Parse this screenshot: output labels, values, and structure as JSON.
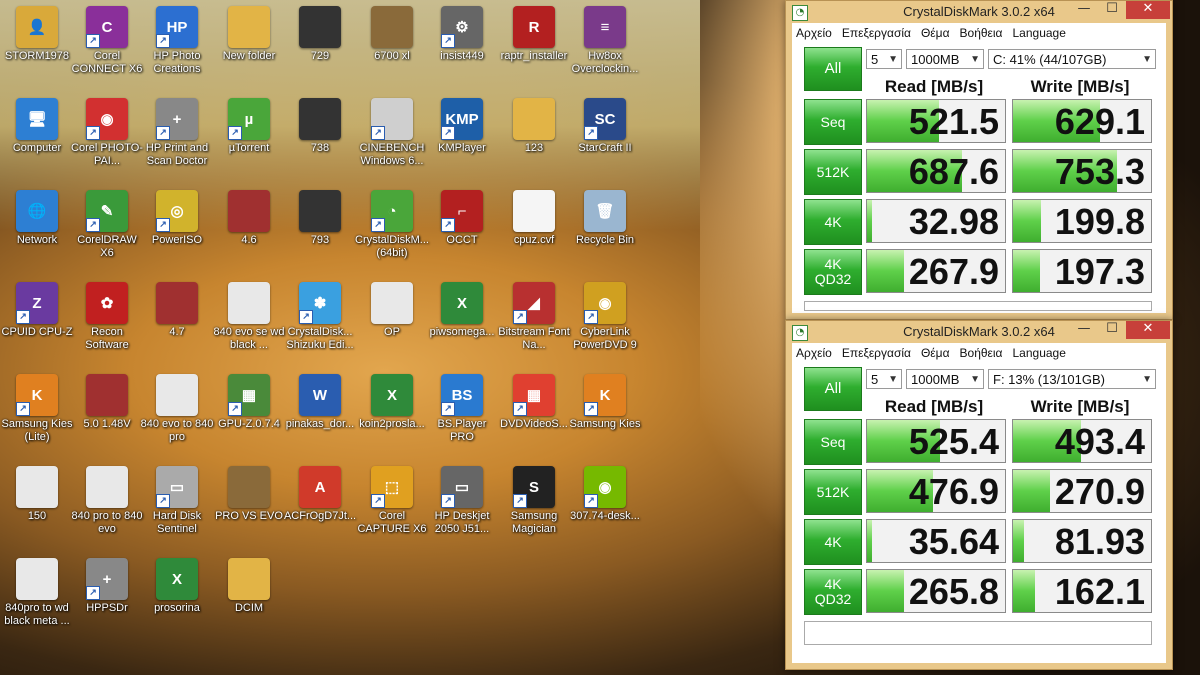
{
  "colors": {
    "window_frame": "#e9c88a",
    "close_button": "#c7403a",
    "green_button": "#2fae2f",
    "bar_green": "#5fd04a"
  },
  "desktop_icons": [
    {
      "label": "STORM1978",
      "icon": "user-folder-icon",
      "color": "#d9a93a",
      "glyph": "👤",
      "shortcut": false
    },
    {
      "label": "Corel CONNECT X6",
      "icon": "corel-connect-icon",
      "color": "#8a2f9a",
      "glyph": "C",
      "shortcut": true
    },
    {
      "label": "HP Photo Creations",
      "icon": "hp-photo-icon",
      "color": "#2c6fd1",
      "glyph": "HP",
      "shortcut": true
    },
    {
      "label": "New folder",
      "icon": "folder-icon",
      "color": "#e2b446",
      "glyph": "",
      "shortcut": false
    },
    {
      "label": "729",
      "icon": "image-thumb-icon",
      "color": "#333333",
      "glyph": "",
      "shortcut": false
    },
    {
      "label": "6700 xl",
      "icon": "image-thumb-icon",
      "color": "#8a6a3a",
      "glyph": "",
      "shortcut": false
    },
    {
      "label": "insist449",
      "icon": "installer-icon",
      "color": "#666666",
      "glyph": "⚙",
      "shortcut": true
    },
    {
      "label": "raptr_installer",
      "icon": "raptr-icon",
      "color": "#b32020",
      "glyph": "R",
      "shortcut": false
    },
    {
      "label": "Hw8ox Overclockin...",
      "icon": "winrar-icon",
      "color": "#7a3a8a",
      "glyph": "≡",
      "shortcut": false
    },
    {
      "label": "Computer",
      "icon": "computer-icon",
      "color": "#2d7fd3",
      "glyph": "🖥",
      "shortcut": false
    },
    {
      "label": "Corel PHOTO-PAI...",
      "icon": "corel-photopaint-icon",
      "color": "#d23030",
      "glyph": "◉",
      "shortcut": true
    },
    {
      "label": "HP Print and Scan Doctor",
      "icon": "hp-doctor-icon",
      "color": "#888888",
      "glyph": "+",
      "shortcut": true
    },
    {
      "label": "µTorrent",
      "icon": "utorrent-icon",
      "color": "#4aa63a",
      "glyph": "µ",
      "shortcut": true
    },
    {
      "label": "738",
      "icon": "image-thumb-icon",
      "color": "#333333",
      "glyph": "",
      "shortcut": false
    },
    {
      "label": "CINEBENCH Windows 6...",
      "icon": "cinebench-icon",
      "color": "#cfcfcf",
      "glyph": "",
      "shortcut": true
    },
    {
      "label": "KMPlayer",
      "icon": "kmplayer-icon",
      "color": "#1e5fa8",
      "glyph": "KMP",
      "shortcut": true
    },
    {
      "label": "123",
      "icon": "folder-icon",
      "color": "#e2b446",
      "glyph": "",
      "shortcut": false
    },
    {
      "label": "StarCraft II",
      "icon": "starcraft-icon",
      "color": "#2a4a8a",
      "glyph": "SC",
      "shortcut": true
    },
    {
      "label": "Network",
      "icon": "network-icon",
      "color": "#2d7fd3",
      "glyph": "🌐",
      "shortcut": false
    },
    {
      "label": "CorelDRAW X6",
      "icon": "coreldraw-icon",
      "color": "#3a9a3a",
      "glyph": "✎",
      "shortcut": true
    },
    {
      "label": "PowerISO",
      "icon": "poweriso-icon",
      "color": "#d1b32c",
      "glyph": "◎",
      "shortcut": true
    },
    {
      "label": "4.6",
      "icon": "image-thumb-icon",
      "color": "#a03030",
      "glyph": "",
      "shortcut": false
    },
    {
      "label": "793",
      "icon": "image-thumb-icon",
      "color": "#333333",
      "glyph": "",
      "shortcut": false
    },
    {
      "label": "CrystalDiskM... (64bit)",
      "icon": "crystaldiskmark-icon",
      "color": "#4aa63a",
      "glyph": "◔",
      "shortcut": true
    },
    {
      "label": "OCCT",
      "icon": "occt-icon",
      "color": "#b32020",
      "glyph": "⌐",
      "shortcut": true
    },
    {
      "label": "cpuz.cvf",
      "icon": "file-icon",
      "color": "#f5f5f5",
      "glyph": "",
      "shortcut": false
    },
    {
      "label": "Recycle Bin",
      "icon": "recycle-bin-icon",
      "color": "#9ab6d0",
      "glyph": "🗑",
      "shortcut": false
    },
    {
      "label": "CPUID CPU-Z",
      "icon": "cpuz-icon",
      "color": "#6a3aa0",
      "glyph": "Z",
      "shortcut": true
    },
    {
      "label": "Recon Software",
      "icon": "recon-icon",
      "color": "#c12020",
      "glyph": "✿",
      "shortcut": false
    },
    {
      "label": "4.7",
      "icon": "image-thumb-icon",
      "color": "#a03030",
      "glyph": "",
      "shortcut": false
    },
    {
      "label": "840 evo se wd black ...",
      "icon": "image-thumb-icon",
      "color": "#e8e8e8",
      "glyph": "",
      "shortcut": false
    },
    {
      "label": "CrystalDisk... Shizuku Edi...",
      "icon": "crystaldisk-shizuku-icon",
      "color": "#3aa0e0",
      "glyph": "✽",
      "shortcut": true
    },
    {
      "label": "OP",
      "icon": "image-thumb-icon",
      "color": "#e8e8e8",
      "glyph": "",
      "shortcut": false
    },
    {
      "label": "piwsomega...",
      "icon": "excel-icon",
      "color": "#2f8a3a",
      "glyph": "X",
      "shortcut": false
    },
    {
      "label": "Bitstream Font Na...",
      "icon": "bitstream-icon",
      "color": "#b83030",
      "glyph": "◢",
      "shortcut": true
    },
    {
      "label": "CyberLink PowerDVD 9",
      "icon": "powerdvd-icon",
      "color": "#d0a020",
      "glyph": "◉",
      "shortcut": true
    },
    {
      "label": "Samsung Kies (Lite)",
      "icon": "kies-lite-icon",
      "color": "#e08020",
      "glyph": "K",
      "shortcut": true
    },
    {
      "label": "5.0 1.48V",
      "icon": "image-thumb-icon",
      "color": "#a03030",
      "glyph": "",
      "shortcut": false
    },
    {
      "label": "840 evo to 840 pro",
      "icon": "image-thumb-icon",
      "color": "#e8e8e8",
      "glyph": "",
      "shortcut": false
    },
    {
      "label": "GPU-Z.0.7.4",
      "icon": "gpuz-icon",
      "color": "#4a8a3a",
      "glyph": "▦",
      "shortcut": true
    },
    {
      "label": "pinakas_dor...",
      "icon": "word-icon",
      "color": "#2a5db0",
      "glyph": "W",
      "shortcut": false
    },
    {
      "label": "koin2prosla...",
      "icon": "excel-icon",
      "color": "#2f8a3a",
      "glyph": "X",
      "shortcut": false
    },
    {
      "label": "BS.Player PRO",
      "icon": "bsplayer-icon",
      "color": "#2a7ad0",
      "glyph": "BS",
      "shortcut": true
    },
    {
      "label": "DVDVideoS...",
      "icon": "dvdvideosoft-icon",
      "color": "#e04030",
      "glyph": "▦",
      "shortcut": true
    },
    {
      "label": "Samsung Kies",
      "icon": "kies-icon",
      "color": "#e08020",
      "glyph": "K",
      "shortcut": true
    },
    {
      "label": "150",
      "icon": "image-thumb-icon",
      "color": "#e8e8e8",
      "glyph": "",
      "shortcut": false
    },
    {
      "label": "840 pro to 840 evo",
      "icon": "image-thumb-icon",
      "color": "#e8e8e8",
      "glyph": "",
      "shortcut": false
    },
    {
      "label": "Hard Disk Sentinel",
      "icon": "hdsentinel-icon",
      "color": "#aaaaaa",
      "glyph": "▭",
      "shortcut": true
    },
    {
      "label": "PRO VS EVO",
      "icon": "image-thumb-icon",
      "color": "#8a6a3a",
      "glyph": "",
      "shortcut": false
    },
    {
      "label": "ACFrOgD7Jt...",
      "icon": "pdf-icon",
      "color": "#d03a2a",
      "glyph": "A",
      "shortcut": false
    },
    {
      "label": "Corel CAPTURE X6",
      "icon": "corel-capture-icon",
      "color": "#e0a020",
      "glyph": "⬚",
      "shortcut": true
    },
    {
      "label": "HP Deskjet 2050 J51...",
      "icon": "printer-icon",
      "color": "#666666",
      "glyph": "▭",
      "shortcut": true
    },
    {
      "label": "Samsung Magician",
      "icon": "samsung-magician-icon",
      "color": "#222222",
      "glyph": "S",
      "shortcut": true
    },
    {
      "label": "307.74-desk...",
      "icon": "nvidia-icon",
      "color": "#76b900",
      "glyph": "◉",
      "shortcut": true
    },
    {
      "label": "840pro to wd black meta ...",
      "icon": "image-thumb-icon",
      "color": "#e8e8e8",
      "glyph": "",
      "shortcut": false
    },
    {
      "label": "HPPSDr",
      "icon": "hppsdr-icon",
      "color": "#888888",
      "glyph": "+",
      "shortcut": true
    },
    {
      "label": "prosorina",
      "icon": "excel-icon",
      "color": "#2f8a3a",
      "glyph": "X",
      "shortcut": false
    },
    {
      "label": "DCIM",
      "icon": "folder-icon",
      "color": "#e2b446",
      "glyph": "",
      "shortcut": false
    }
  ],
  "windows": [
    {
      "title": "CrystalDiskMark 3.0.2 x64",
      "menu": [
        "Αρχείο",
        "Επεξεργασία",
        "Θέμα",
        "Βοήθεια",
        "Language"
      ],
      "all_label": "All",
      "runs": "5",
      "size": "1000MB",
      "drive": "C: 41% (44/107GB)",
      "read_header": "Read [MB/s]",
      "write_header": "Write [MB/s]",
      "rows": [
        {
          "label": "Seq",
          "read": "521.5",
          "write": "629.1"
        },
        {
          "label": "512K",
          "read": "687.6",
          "write": "753.3"
        },
        {
          "label": "4K",
          "read": "32.98",
          "write": "199.8"
        },
        {
          "label": "4K QD32",
          "read": "267.9",
          "write": "197.3"
        }
      ],
      "comment": ""
    },
    {
      "title": "CrystalDiskMark 3.0.2 x64",
      "menu": [
        "Αρχείο",
        "Επεξεργασία",
        "Θέμα",
        "Βοήθεια",
        "Language"
      ],
      "all_label": "All",
      "runs": "5",
      "size": "1000MB",
      "drive": "F: 13% (13/101GB)",
      "read_header": "Read [MB/s]",
      "write_header": "Write [MB/s]",
      "rows": [
        {
          "label": "Seq",
          "read": "525.4",
          "write": "493.4"
        },
        {
          "label": "512K",
          "read": "476.9",
          "write": "270.9"
        },
        {
          "label": "4K",
          "read": "35.64",
          "write": "81.93"
        },
        {
          "label": "4K QD32",
          "read": "265.8",
          "write": "162.1"
        }
      ],
      "comment": ""
    }
  ],
  "window_controls": {
    "minimize": "—",
    "maximize": "☐",
    "close": "✕"
  },
  "dropdown_arrow": "▼"
}
